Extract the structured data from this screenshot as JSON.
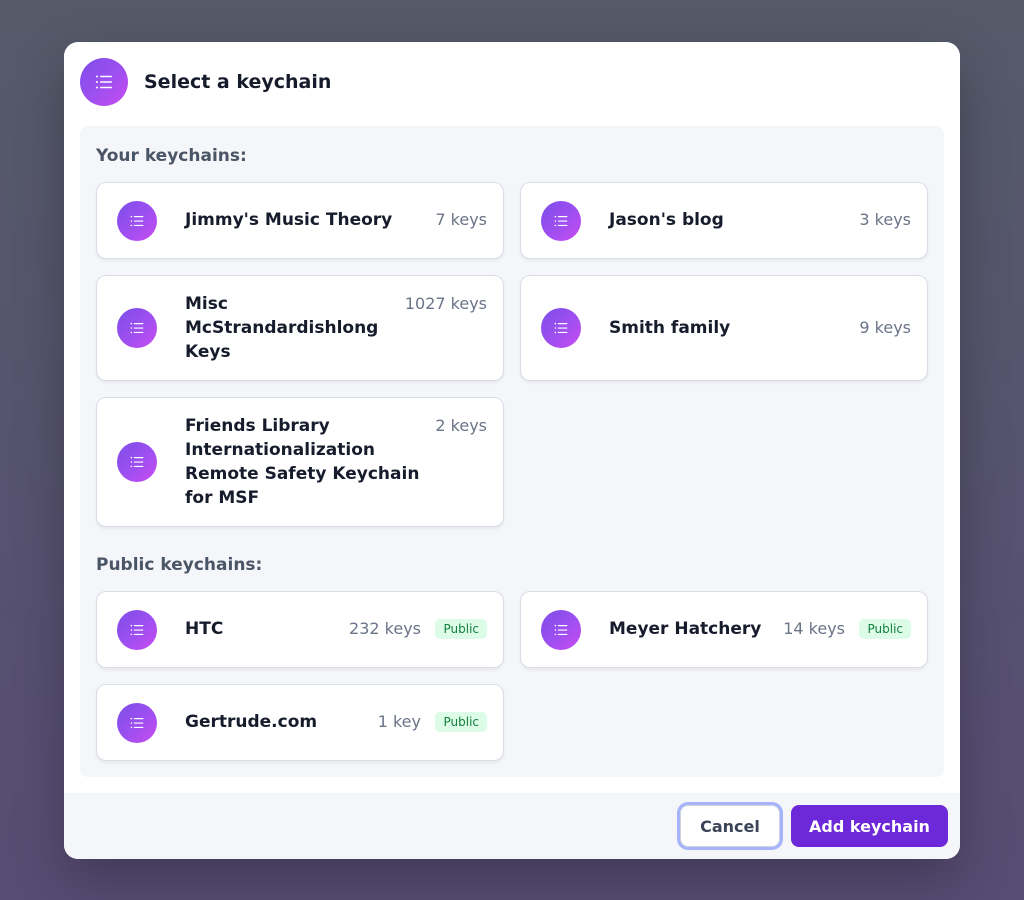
{
  "dialog": {
    "title": "Select a keychain",
    "icon": "list-icon"
  },
  "your_section": {
    "label": "Your keychains:",
    "items": [
      {
        "name": "Jimmy's Music Theory",
        "count": "7 keys"
      },
      {
        "name": "Jason's blog",
        "count": "3 keys"
      },
      {
        "name": "Misc McStrandardishlong Keys",
        "count": "1027 keys"
      },
      {
        "name": "Smith family",
        "count": "9 keys"
      },
      {
        "name": "Friends Library Internationalization Remote Safety Keychain for MSF",
        "count": "2 keys"
      }
    ]
  },
  "public_section": {
    "label": "Public keychains:",
    "items": [
      {
        "name": "HTC",
        "count": "232 keys",
        "badge": "Public"
      },
      {
        "name": "Meyer Hatchery",
        "count": "14 keys",
        "badge": "Public"
      },
      {
        "name": "Gertrude.com",
        "count": "1 key",
        "badge": "Public"
      }
    ]
  },
  "footer": {
    "cancel_label": "Cancel",
    "add_label": "Add keychain"
  },
  "colors": {
    "accent": "#6d28d9",
    "icon_gradient_start": "#7c4dea",
    "icon_gradient_end": "#c84cf0",
    "badge_bg": "#dcfce7",
    "badge_text": "#15803d"
  }
}
